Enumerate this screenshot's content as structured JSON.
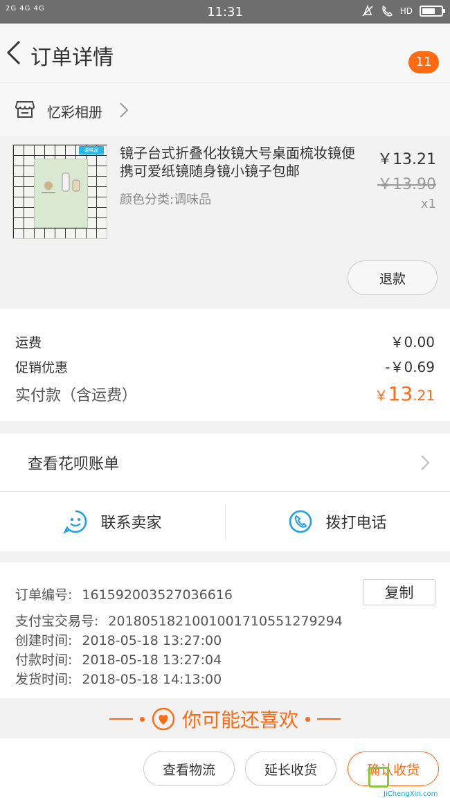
{
  "status_bar": {
    "signal_text": "2G 4G 4G",
    "time": "11:31",
    "hd_label": "HD"
  },
  "header": {
    "title": "订单详情",
    "badge_count": "11"
  },
  "shop": {
    "name": "忆彩相册"
  },
  "product": {
    "title": "镜子台式折叠化妆镜大号桌面梳妆镜便携可爱纸镜随身镜小镜子包邮",
    "sku": "颜色分类:调味品",
    "price": "￥13.21",
    "original_price": "￥13.90",
    "quantity": "x1",
    "thumb_tag": "调味品",
    "refund_label": "退款"
  },
  "fees": {
    "shipping_label": "运费",
    "shipping_value": "￥0.00",
    "discount_label": "促销优惠",
    "discount_value": "-￥0.69",
    "total_label": "实付款（含运费）",
    "total_symbol": "￥",
    "total_int": "13",
    "total_dec": ".21"
  },
  "huabei": {
    "label": "查看花呗账单"
  },
  "contact": {
    "seller_label": "联系卖家",
    "phone_label": "拨打电话"
  },
  "order_info": {
    "order_no_label": "订单编号:",
    "order_no": "161592003527036616",
    "copy_label": "复制",
    "alipay_label": "支付宝交易号:",
    "alipay_no": "2018051821001001710551279294",
    "created_label": "创建时间:",
    "created_time": "2018-05-18 13:27:00",
    "paid_label": "付款时间:",
    "paid_time": "2018-05-18 13:27:04",
    "shipped_label": "发货时间:",
    "shipped_time": "2018-05-18 14:13:00"
  },
  "recommend": {
    "text": "你可能还喜欢"
  },
  "bottom_bar": {
    "logistics_label": "查看物流",
    "extend_label": "延长收货",
    "confirm_label": "确认收货"
  },
  "watermark": {
    "text": "JiChengXin.com"
  },
  "colors": {
    "accent": "#ff6a13",
    "icon_blue": "#1e9fe6"
  }
}
